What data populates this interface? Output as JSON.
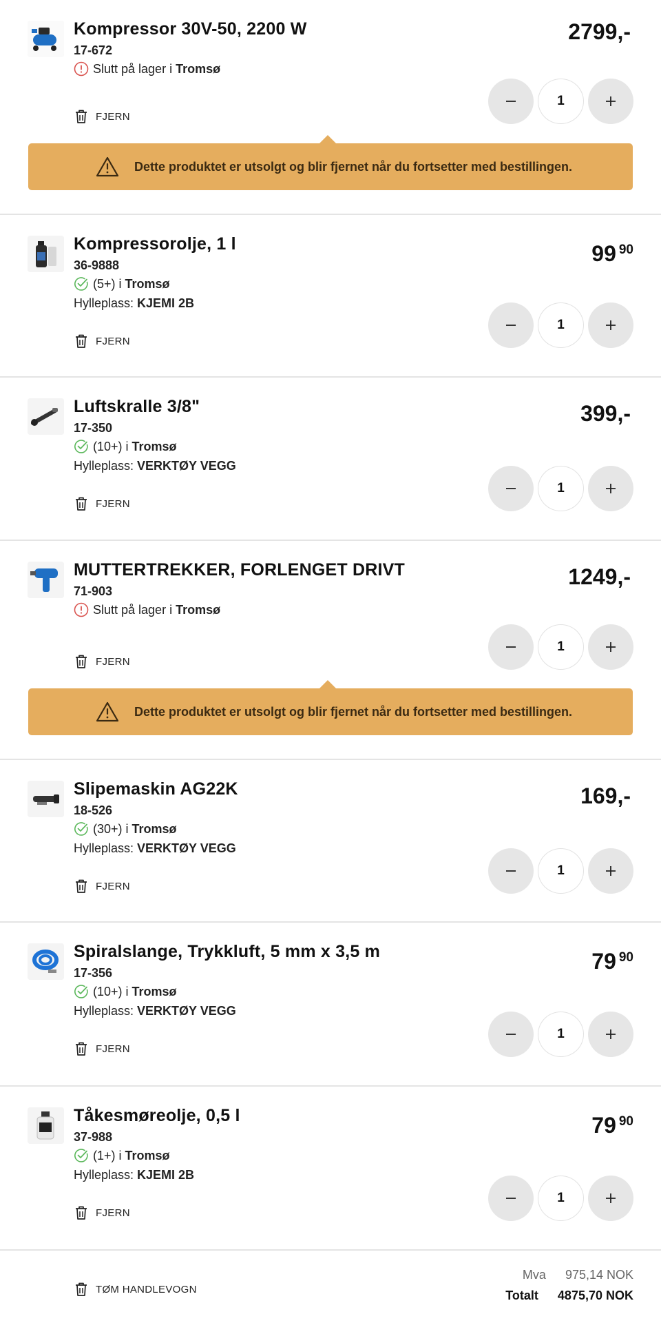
{
  "items": [
    {
      "name": "Kompressor 30V-50, 2200 W",
      "sku": "17-672",
      "stock_text": "Slutt på lager i",
      "stock_location": "Tromsø",
      "stock_status": "out-of-stock",
      "shelf_label": "",
      "shelf_value": "",
      "price_main": "2799,-",
      "price_cents": "",
      "quantity": "1",
      "remove_label": "FJERN",
      "warning": "Dette produktet er utsolgt og blir fjernet når du fortsetter med bestillingen."
    },
    {
      "name": "Kompressorolje, 1 l",
      "sku": "36-9888",
      "stock_text": "(5+) i",
      "stock_location": "Tromsø",
      "stock_status": "in-stock",
      "shelf_label": "Hylleplass:",
      "shelf_value": "KJEMI 2B",
      "price_main": "99",
      "price_cents": "90",
      "quantity": "1",
      "remove_label": "FJERN"
    },
    {
      "name": "Luftskralle 3/8\"",
      "sku": "17-350",
      "stock_text": "(10+) i",
      "stock_location": "Tromsø",
      "stock_status": "in-stock",
      "shelf_label": "Hylleplass:",
      "shelf_value": "VERKTØY VEGG",
      "price_main": "399,-",
      "price_cents": "",
      "quantity": "1",
      "remove_label": "FJERN"
    },
    {
      "name": "MUTTERTREKKER, FORLENGET DRIVT",
      "sku": "71-903",
      "stock_text": "Slutt på lager i",
      "stock_location": "Tromsø",
      "stock_status": "out-of-stock",
      "shelf_label": "",
      "shelf_value": "",
      "price_main": "1249,-",
      "price_cents": "",
      "quantity": "1",
      "remove_label": "FJERN",
      "warning": "Dette produktet er utsolgt og blir fjernet når du fortsetter med bestillingen."
    },
    {
      "name": "Slipemaskin AG22K",
      "sku": "18-526",
      "stock_text": "(30+) i",
      "stock_location": "Tromsø",
      "stock_status": "in-stock",
      "shelf_label": "Hylleplass:",
      "shelf_value": "VERKTØY VEGG",
      "price_main": "169,-",
      "price_cents": "",
      "quantity": "1",
      "remove_label": "FJERN"
    },
    {
      "name": "Spiralslange, Trykkluft, 5 mm x 3,5 m",
      "sku": "17-356",
      "stock_text": "(10+) i",
      "stock_location": "Tromsø",
      "stock_status": "in-stock",
      "shelf_label": "Hylleplass:",
      "shelf_value": "VERKTØY VEGG",
      "price_main": "79",
      "price_cents": "90",
      "quantity": "1",
      "remove_label": "FJERN"
    },
    {
      "name": "Tåkesmøreolje, 0,5 l",
      "sku": "37-988",
      "stock_text": "(1+) i",
      "stock_location": "Tromsø",
      "stock_status": "in-stock",
      "shelf_label": "Hylleplass:",
      "shelf_value": "KJEMI 2B",
      "price_main": "79",
      "price_cents": "90",
      "quantity": "1",
      "remove_label": "FJERN"
    }
  ],
  "footer": {
    "empty_cart_label": "TØM HANDLEVOGN",
    "vat_label": "Mva",
    "vat_value": "975,14 NOK",
    "total_label": "Totalt",
    "total_value": "4875,70 NOK"
  },
  "colors": {
    "warning_bg": "#e5ad5e",
    "in_stock": "#5cb85c",
    "out_of_stock": "#d9534f",
    "qty_button": "#e6e6e6"
  },
  "icons": {
    "in_stock": "check-circle-icon",
    "out_of_stock": "exclamation-circle-icon",
    "remove": "trash-icon",
    "warning": "warning-triangle-icon",
    "minus": "minus-icon",
    "plus": "plus-icon"
  }
}
